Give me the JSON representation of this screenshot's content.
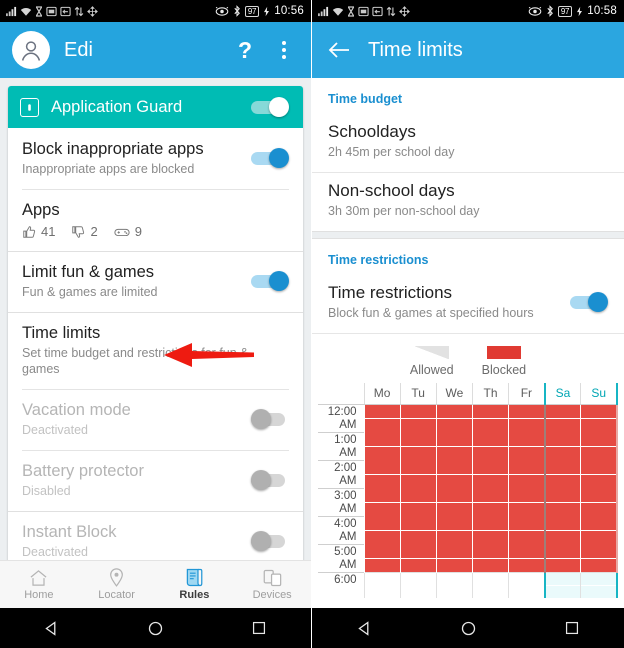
{
  "left": {
    "status_bar": {
      "time": "10:56",
      "battery": "97"
    },
    "app_bar": {
      "title": "Edi",
      "help_label": "?"
    },
    "guard": {
      "title": "Application Guard",
      "enabled": true
    },
    "rows": [
      {
        "title": "Block inappropriate apps",
        "subtitle": "Inappropriate apps are blocked",
        "toggle": "on-blue"
      },
      {
        "title": "Apps",
        "subtitle": "",
        "toggle": "none",
        "counts": {
          "thumbs_up": "41",
          "thumbs_down": "2",
          "games": "9"
        }
      },
      {
        "title": "Limit fun & games",
        "subtitle": "Fun & games are limited",
        "toggle": "on-blue"
      },
      {
        "title": "Time limits",
        "subtitle": "Set time budget and restrictions for fun & games",
        "toggle": "none"
      },
      {
        "title": "Vacation mode",
        "subtitle": "Deactivated",
        "toggle": "off"
      },
      {
        "title": "Battery protector",
        "subtitle": "Disabled",
        "toggle": "off"
      },
      {
        "title": "Instant Block",
        "subtitle": "Deactivated",
        "toggle": "off"
      }
    ],
    "bottom_nav": [
      {
        "label": "Home",
        "active": false
      },
      {
        "label": "Locator",
        "active": false
      },
      {
        "label": "Rules",
        "active": true
      },
      {
        "label": "Devices",
        "active": false
      }
    ]
  },
  "right": {
    "status_bar": {
      "time": "10:58",
      "battery": "97"
    },
    "app_bar": {
      "title": "Time limits"
    },
    "time_budget": {
      "section_label": "Time budget",
      "items": [
        {
          "title": "Schooldays",
          "subtitle": "2h 45m per school day"
        },
        {
          "title": "Non-school days",
          "subtitle": "3h 30m per non-school day"
        }
      ]
    },
    "time_restrictions": {
      "section_label": "Time restrictions",
      "row": {
        "title": "Time restrictions",
        "subtitle": "Block fun & games at specified hours",
        "toggle": "on-blue"
      },
      "legend": [
        {
          "label": "Allowed",
          "color": "#e2e2e2"
        },
        {
          "label": "Blocked",
          "color": "#e03a32"
        }
      ]
    },
    "schedule": {
      "days": [
        "Mo",
        "Tu",
        "We",
        "Th",
        "Fr",
        "Sa",
        "Su"
      ],
      "weekend_days": [
        "Sa",
        "Su"
      ],
      "hours": [
        "12:00 AM",
        "1:00 AM",
        "2:00 AM",
        "3:00 AM",
        "4:00 AM",
        "5:00 AM",
        "6:00"
      ],
      "blocked_hours": [
        "12:00 AM",
        "1:00 AM",
        "2:00 AM",
        "3:00 AM",
        "4:00 AM",
        "5:00 AM"
      ],
      "allowed_hours": [
        "6:00"
      ]
    }
  },
  "colors": {
    "app_bar": "#25a4de",
    "guard_header": "#00bcb4",
    "accent_blue": "#1a8fd0",
    "blocked_red": "#e54a42",
    "weekend_teal": "#17b5c4",
    "annotation_arrow": "#ee1b11"
  }
}
